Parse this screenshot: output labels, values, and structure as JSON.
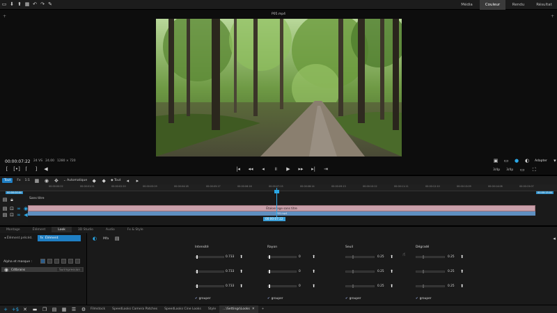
{
  "colors": {
    "accent": "#1f7fc4",
    "playhead": "#2aa7e6",
    "clip": "#c9a0aa"
  },
  "topbar": {
    "tool_icons": [
      "new-project-icon",
      "save-icon",
      "export-icon",
      "undo-icon",
      "redo-icon",
      "wrench-icon"
    ],
    "tabs": [
      {
        "label": "Média",
        "active": false
      },
      {
        "label": "Couleur",
        "active": true
      },
      {
        "label": "Rendu",
        "active": false
      },
      {
        "label": "Résultat",
        "active": false
      }
    ]
  },
  "viewer": {
    "filename": "P05.mp4",
    "timecode": "00:00:07:22",
    "fps_info": "24 VS",
    "fps2": "24.00",
    "resolution": "1280 × 720",
    "zoom_label": "Adapter",
    "ratio_a": "3/4p",
    "ratio_b": "3/4p"
  },
  "timeline": {
    "toolbar": {
      "all_label": "Tout",
      "fx_label": "Fx",
      "one_label": "1:1",
      "auto_label": "Automatique",
      "all2_label": "Tout"
    },
    "tc_start": "00:00:00:00",
    "tc_end": "00:00:15:00",
    "ticks": [
      "00:00:00:22",
      "00:00:01:21",
      "00:00:02:20",
      "00:00:03:19",
      "00:00:04:18",
      "00:00:05:17",
      "00:00:06:16",
      "00:00:07:15",
      "00:00:08:14",
      "00:00:09:13",
      "00:00:10:12",
      "00:00:11:11",
      "00:00:12:10",
      "00:00:13:09",
      "00:00:14:08",
      "00:00:15:07"
    ],
    "sequence_title": "Sans titre",
    "clip_label": "Étalonnage sans titre",
    "clip_sub": "P05.mp4",
    "playhead_time": "00:00:07:22"
  },
  "panel": {
    "tabs": [
      {
        "label": "Montage",
        "active": false
      },
      {
        "label": "Élément",
        "active": false
      },
      {
        "label": "Look",
        "active": true
      },
      {
        "label": "3D Studio",
        "active": false
      },
      {
        "label": "Audio",
        "active": false
      },
      {
        "label": "Fx & Style",
        "active": false
      }
    ],
    "element_prev": "Élément précéd.",
    "element_current": "Élément",
    "alpha_label": "Alpha et masque :",
    "layer_name": "Cdtbrains",
    "layer_right": "Surimpression",
    "fx_title": "Mfa",
    "columns": [
      {
        "title": "Intensité",
        "values": [
          "0.733",
          "0.733",
          "0.733"
        ]
      },
      {
        "title": "Rayon",
        "values": [
          "0",
          "0",
          "0"
        ]
      },
      {
        "title": "Seuil",
        "values": [
          "0.25",
          "0.25",
          "0.25"
        ]
      },
      {
        "title": "Dégradé",
        "values": [
          "0.25",
          "0.25",
          "0.25"
        ]
      }
    ],
    "grouper_label": "grouper"
  },
  "bottombar": {
    "tabs": [
      {
        "label": "Filmstock",
        "active": false
      },
      {
        "label": "SpeedLooks Camera Patches",
        "active": false
      },
      {
        "label": "SpeedLooks Cine Looks",
        "active": false
      },
      {
        "label": "Style",
        "active": false
      },
      {
        "label": "...\\Settings\\Looks",
        "active": true
      }
    ]
  }
}
